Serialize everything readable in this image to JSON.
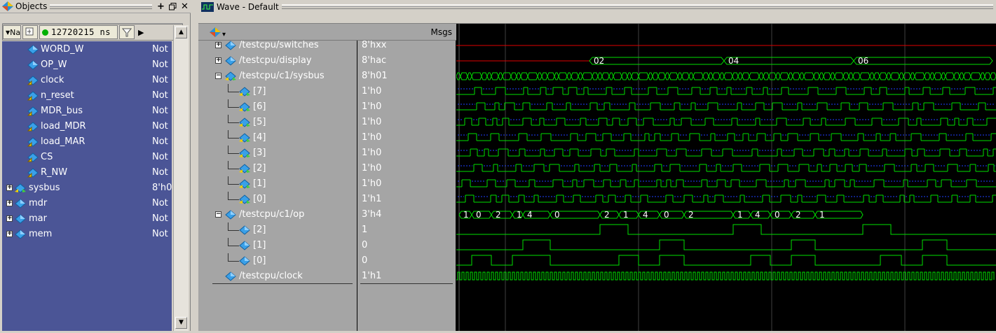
{
  "objects_pane": {
    "title": "Objects",
    "name_col_label": "Na",
    "sim_time": "12720215 ns",
    "items": [
      {
        "name": "WORD_W",
        "value": "Not",
        "icon": "signal-diamond-icon",
        "expandable": false
      },
      {
        "name": "OP_W",
        "value": "Not",
        "icon": "signal-diamond-icon",
        "expandable": false
      },
      {
        "name": "clock",
        "value": "Not",
        "icon": "input-port-icon",
        "expandable": false
      },
      {
        "name": "n_reset",
        "value": "Not",
        "icon": "input-port-icon",
        "expandable": false
      },
      {
        "name": "MDR_bus",
        "value": "Not",
        "icon": "input-port-icon",
        "expandable": false
      },
      {
        "name": "load_MDR",
        "value": "Not",
        "icon": "input-port-icon",
        "expandable": false
      },
      {
        "name": "load_MAR",
        "value": "Not",
        "icon": "input-port-icon",
        "expandable": false
      },
      {
        "name": "CS",
        "value": "Not",
        "icon": "input-port-icon",
        "expandable": false
      },
      {
        "name": "R_NW",
        "value": "Not",
        "icon": "input-port-icon",
        "expandable": false
      },
      {
        "name": "sysbus",
        "value": "8'h0",
        "icon": "inout-port-icon",
        "expandable": true
      },
      {
        "name": "mdr",
        "value": "Not",
        "icon": "signal-diamond-icon",
        "expandable": true
      },
      {
        "name": "mar",
        "value": "Not",
        "icon": "signal-diamond-icon",
        "expandable": true
      },
      {
        "name": "mem",
        "value": "Not",
        "icon": "signal-diamond-icon",
        "expandable": true
      }
    ]
  },
  "wave_window": {
    "title": "Wave - Default",
    "msgs_header": "Msgs",
    "signals": [
      {
        "name": "/testcpu/switches",
        "value": "8'hxx",
        "level": 0,
        "expand": "plus",
        "icon": "signal-diamond-icon"
      },
      {
        "name": "/testcpu/display",
        "value": "8'hac",
        "level": 0,
        "expand": "plus",
        "icon": "signal-diamond-icon"
      },
      {
        "name": "/testcpu/c1/sysbus",
        "value": "8'h01",
        "level": 0,
        "expand": "minus",
        "icon": "inout-port-icon"
      },
      {
        "name": "[7]",
        "value": "1'h0",
        "level": 1,
        "expand": "",
        "icon": "inout-port-icon"
      },
      {
        "name": "[6]",
        "value": "1'h0",
        "level": 1,
        "expand": "",
        "icon": "inout-port-icon"
      },
      {
        "name": "[5]",
        "value": "1'h0",
        "level": 1,
        "expand": "",
        "icon": "inout-port-icon"
      },
      {
        "name": "[4]",
        "value": "1'h0",
        "level": 1,
        "expand": "",
        "icon": "inout-port-icon"
      },
      {
        "name": "[3]",
        "value": "1'h0",
        "level": 1,
        "expand": "",
        "icon": "inout-port-icon"
      },
      {
        "name": "[2]",
        "value": "1'h0",
        "level": 1,
        "expand": "",
        "icon": "inout-port-icon"
      },
      {
        "name": "[1]",
        "value": "1'h0",
        "level": 1,
        "expand": "",
        "icon": "inout-port-icon"
      },
      {
        "name": "[0]",
        "value": "1'h1",
        "level": 1,
        "expand": "",
        "icon": "inout-port-icon"
      },
      {
        "name": "/testcpu/c1/op",
        "value": "3'h4",
        "level": 0,
        "expand": "minus",
        "icon": "signal-diamond-icon"
      },
      {
        "name": "[2]",
        "value": "1",
        "level": 1,
        "expand": "",
        "icon": "signal-diamond-icon"
      },
      {
        "name": "[1]",
        "value": "0",
        "level": 1,
        "expand": "",
        "icon": "signal-diamond-icon"
      },
      {
        "name": "[0]",
        "value": "0",
        "level": 1,
        "expand": "",
        "icon": "signal-diamond-icon"
      },
      {
        "name": "/testcpu/clock",
        "value": "1'h1",
        "level": 0,
        "expand": "",
        "icon": "signal-diamond-icon"
      }
    ],
    "display_bus_labels": [
      "02",
      "04",
      "06"
    ],
    "op_bus_labels": [
      "1",
      "0",
      "2",
      "1",
      "4",
      "0",
      "2",
      "1",
      "4",
      "0",
      "2",
      "1",
      "4",
      "0",
      "2",
      "1"
    ],
    "colors": {
      "wave_green": "#00e000",
      "wave_blue": "#2040ff",
      "wave_red": "#e00000",
      "cursor_gray": "#606060",
      "grid": "#404040"
    }
  }
}
